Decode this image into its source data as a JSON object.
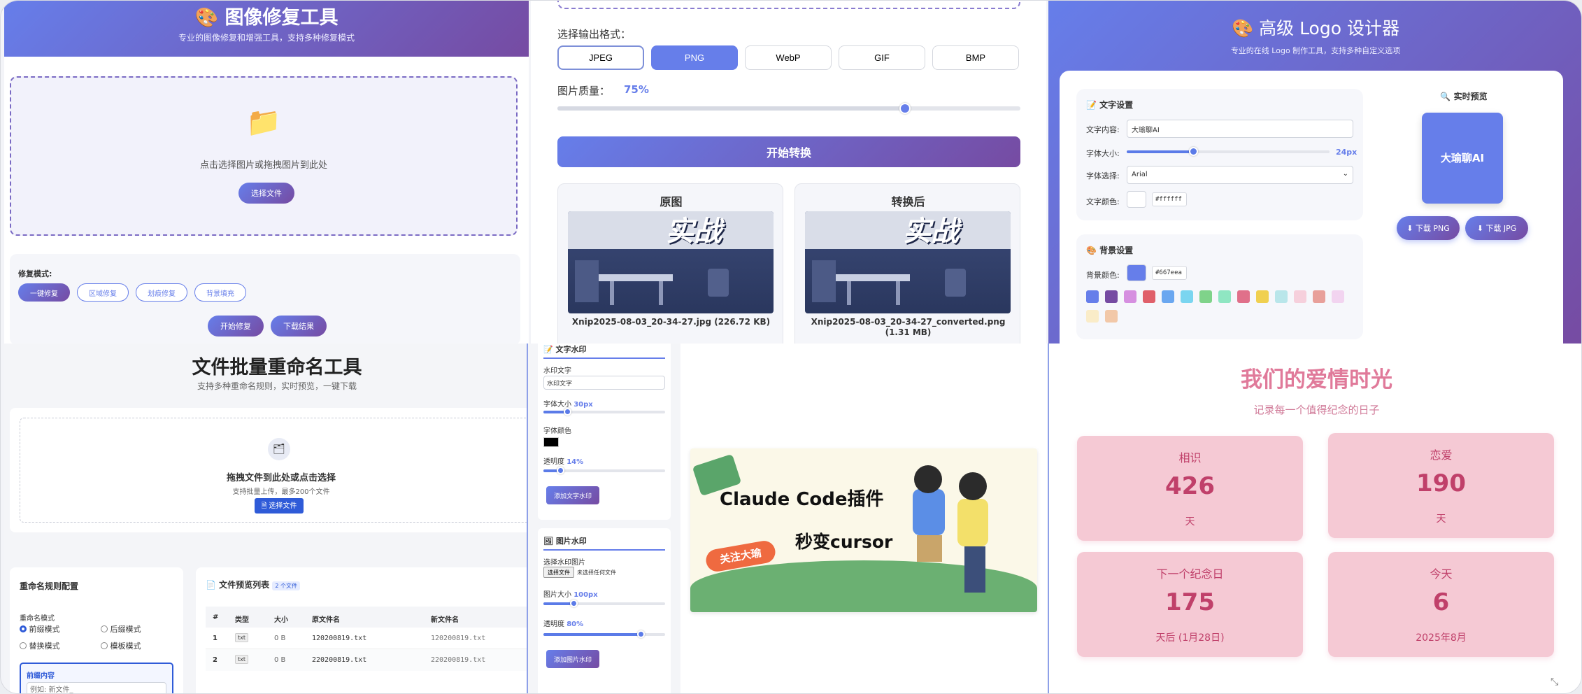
{
  "p1": {
    "title": "图像修复工具",
    "subtitle": "专业的图像修复和增强工具，支持多种修复模式",
    "drop_text": "点击选择图片或拖拽图片到此处",
    "select_btn": "选择文件",
    "mode_label": "修复模式:",
    "modes": [
      "一键修复",
      "区域修复",
      "划痕修复",
      "背景填充"
    ],
    "start_btn": "开始修复",
    "download_btn": "下载结果"
  },
  "p2": {
    "format_label": "选择输出格式：",
    "formats": [
      "JPEG",
      "PNG",
      "WebP",
      "GIF",
      "BMP"
    ],
    "active_format": "PNG",
    "quality_label": "图片质量：",
    "quality_value": "75%",
    "quality": 0.75,
    "convert_btn": "开始转换",
    "orig_title": "原图",
    "conv_title": "转换后",
    "banner_text": "实战",
    "orig_file": "Xnip2025-08-03_20-34-27.jpg (226.72 KB)",
    "conv_file": "Xnip2025-08-03_20-34-27_converted.png (1.31 MB)"
  },
  "p3": {
    "title": "高级 Logo 设计器",
    "subtitle": "专业的在线 Logo 制作工具，支持多种自定义选项",
    "text_section": "文字设置",
    "content_label": "文字内容:",
    "content_value": "大瑜聊AI",
    "size_label": "字体大小:",
    "size_value": "24px",
    "size": 0.33,
    "font_label": "字体选择:",
    "font_value": "Arial",
    "color_label": "文字颜色:",
    "color_value": "#ffffff",
    "bg_section": "背景设置",
    "bg_label": "背景颜色:",
    "bg_value": "#667eea",
    "swatches": [
      "#667eea",
      "#764ba2",
      "#d68fe0",
      "#e0606a",
      "#6aa7f0",
      "#7ad5f0",
      "#7fd38a",
      "#8fe6c2",
      "#e0708a",
      "#f0d050",
      "#b9e6ea",
      "#f6d0dc",
      "#e8a09a",
      "#f2d4f0",
      "#faecc8",
      "#f2c8a8"
    ],
    "preview_title": "实时预览",
    "preview_text": "大瑜聊AI",
    "dl_png": "下载 PNG",
    "dl_jpg": "下载 JPG"
  },
  "p4": {
    "title": "文件批量重命名工具",
    "subtitle": "支持多种重命名规则，实时预览，一键下载",
    "drop_title": "拖拽文件到此处或点击选择",
    "drop_sub": "支持批量上传，最多200个文件",
    "select_btn": "选择文件",
    "config_title": "重命名规则配置",
    "mode_label": "重命名模式",
    "radios": [
      "前缀模式",
      "后缀模式",
      "替换模式",
      "模板模式"
    ],
    "prefix_label": "前缀内容",
    "prefix_placeholder": "例如: 新文件_",
    "list_title": "文件预览列表",
    "list_badge": "2 个文件",
    "cols": [
      "#",
      "类型",
      "大小",
      "原文件名",
      "新文件名"
    ],
    "rows": [
      [
        "1",
        "txt",
        "0 B",
        "120200819.txt",
        "120200819.txt"
      ],
      [
        "2",
        "txt",
        "0 B",
        "220200819.txt",
        "220200819.txt"
      ]
    ]
  },
  "p5": {
    "text_section": "文字水印",
    "wm_text_label": "水印文字",
    "wm_text_value": "水印文字",
    "size_label": "字体大小",
    "size_value": "30px",
    "size": 0.2,
    "color_label": "字体颜色",
    "color_value": "#000000",
    "opacity_label": "透明度",
    "opacity_value": "14%",
    "opacity": 0.14,
    "add_text_btn": "添加文字水印",
    "img_section": "图片水印",
    "choose_label": "选择水印图片",
    "choose_btn": "选择文件",
    "no_file": "未选择任何文件",
    "img_size_label": "图片大小",
    "img_size_value": "100px",
    "img_size": 0.25,
    "img_opacity_label": "透明度",
    "img_opacity_value": "80%",
    "img_opacity": 0.8,
    "add_img_btn": "添加图片水印",
    "cover_title": "Claude Code插件",
    "cover_sub": "秒变cursor",
    "cover_tag": "关注大瑜"
  },
  "p6": {
    "title": "我们的爱情时光",
    "subtitle": "记录每一个值得纪念的日子",
    "cards": [
      {
        "label": "相识",
        "value": "426",
        "unit": "天"
      },
      {
        "label": "恋爱",
        "value": "190",
        "unit": "天"
      },
      {
        "label": "下一个纪念日",
        "value": "175",
        "unit": "天后 (1月28日)"
      },
      {
        "label": "今天",
        "value": "6",
        "unit": "2025年8月"
      }
    ]
  },
  "colors": {
    "accent": "#667eea",
    "accent2": "#764ba2",
    "pink": "#e07a9a"
  }
}
